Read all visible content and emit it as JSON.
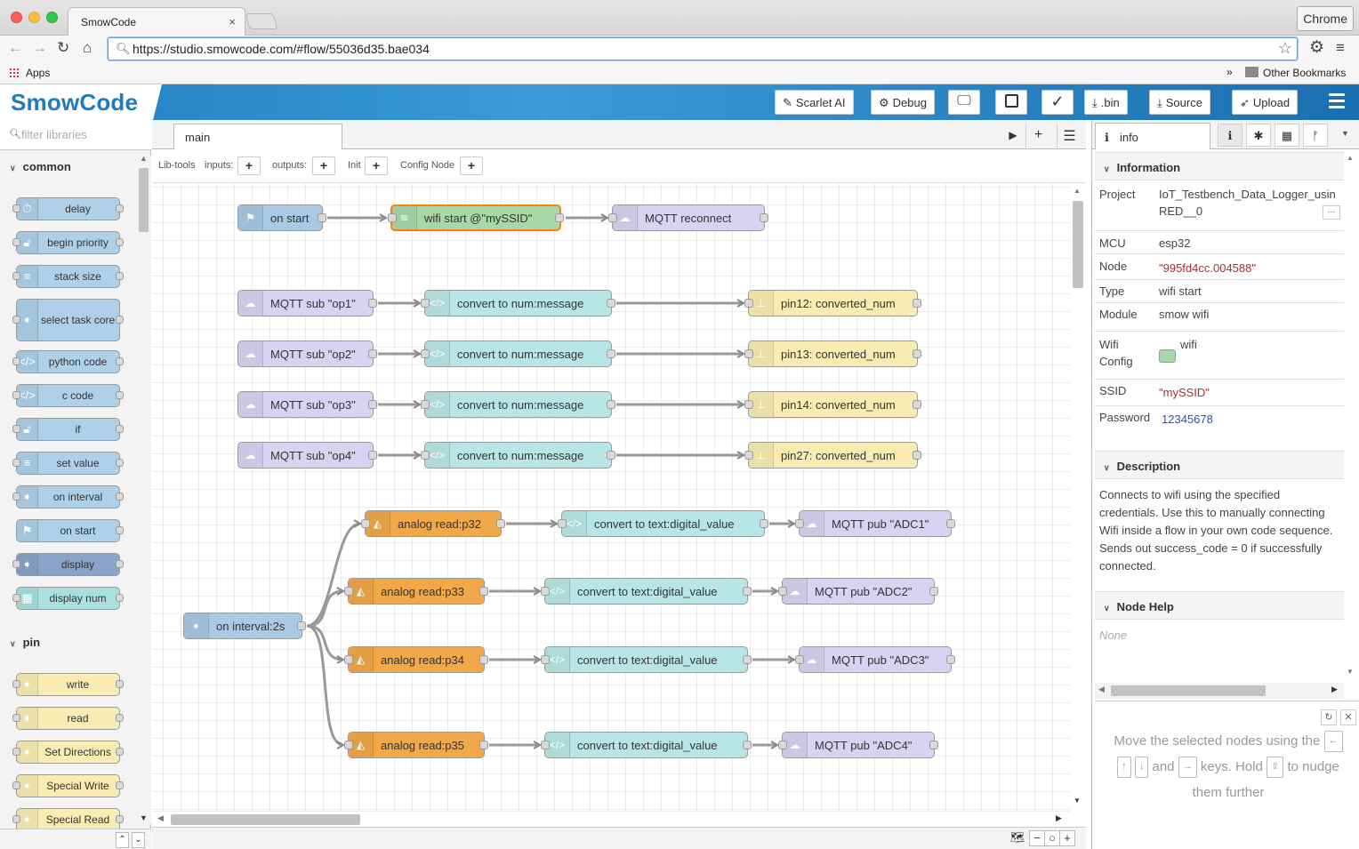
{
  "browser": {
    "tab_title": "SmowCode",
    "tab_close": "×",
    "url": "https://studio.smowcode.com/#flow/55036d35.bae034",
    "chrome_label": "Chrome",
    "bookmarks": {
      "apps": "Apps",
      "overflow": "»",
      "other": "Other Bookmarks"
    }
  },
  "header": {
    "logo": "SmowCode",
    "buttons": {
      "scarlet": "Scarlet AI",
      "debug": "Debug",
      "bin": ".bin",
      "source": "Source",
      "upload": "Upload"
    }
  },
  "palette": {
    "filter_placeholder": "filter libraries",
    "categories": [
      {
        "name": "common",
        "nodes": [
          {
            "label": "delay",
            "color": "#aed0e8"
          },
          {
            "label": "begin priority",
            "color": "#aed0e8"
          },
          {
            "label": "stack size",
            "color": "#aed0e8"
          },
          {
            "label": "select task core",
            "color": "#aed0e8"
          },
          {
            "label": "python code",
            "color": "#aed0e8"
          },
          {
            "label": "c code",
            "color": "#aed0e8"
          },
          {
            "label": "if",
            "color": "#aed0e8"
          },
          {
            "label": "set value",
            "color": "#aed0e8"
          },
          {
            "label": "on interval",
            "color": "#aed0e8"
          },
          {
            "label": "on start",
            "color": "#aed0e8"
          },
          {
            "label": "display",
            "color": "#8aa3c8"
          },
          {
            "label": "display num",
            "color": "#a8e0e0"
          }
        ]
      },
      {
        "name": "pin",
        "nodes": [
          {
            "label": "write",
            "color": "#f8ecb2"
          },
          {
            "label": "read",
            "color": "#f8ecb2"
          },
          {
            "label": "Set Directions",
            "color": "#f8ecb2"
          },
          {
            "label": "Special Write",
            "color": "#f8ecb2"
          },
          {
            "label": "Special Read",
            "color": "#f8ecb2"
          }
        ]
      }
    ]
  },
  "workspace": {
    "tab": "main",
    "libtools": {
      "label": "Lib-tools",
      "inputs": "inputs:",
      "outputs": "outputs:",
      "init": "Init",
      "config": "Config Node"
    },
    "nodes": {
      "on_start": {
        "label": "on start",
        "color": "#a9c9e4"
      },
      "wifi_start": {
        "label": "wifi start @\"mySSID\"",
        "color": "#a8d8a8"
      },
      "mqtt_reconnect": {
        "label": "MQTT reconnect",
        "color": "#d9d2f0"
      },
      "sub1": {
        "label": "MQTT sub \"op1\"",
        "color": "#d9d2f0"
      },
      "sub2": {
        "label": "MQTT sub \"op2\"",
        "color": "#d9d2f0"
      },
      "sub3": {
        "label": "MQTT sub \"op3\"",
        "color": "#d9d2f0"
      },
      "sub4": {
        "label": "MQTT sub \"op4\"",
        "color": "#d9d2f0"
      },
      "conv_num": {
        "label": "convert to num:message",
        "color": "#b8e6e6"
      },
      "pin12": {
        "label": "pin12: converted_num",
        "color": "#f8ecb2"
      },
      "pin13": {
        "label": "pin13: converted_num",
        "color": "#f8ecb2"
      },
      "pin14": {
        "label": "pin14: converted_num",
        "color": "#f8ecb2"
      },
      "pin27": {
        "label": "pin27: converted_num",
        "color": "#f8ecb2"
      },
      "on_interval": {
        "label": "on interval:2s",
        "color": "#a9c9e4"
      },
      "ar32": {
        "label": "analog read:p32",
        "color": "#f0a848"
      },
      "ar33": {
        "label": "analog read:p33",
        "color": "#f0a848"
      },
      "ar34": {
        "label": "analog read:p34",
        "color": "#f0a848"
      },
      "ar35": {
        "label": "analog read:p35",
        "color": "#f0a848"
      },
      "conv_text": {
        "label": "convert to text:digital_value",
        "color": "#b8e6e6"
      },
      "pub1": {
        "label": "MQTT pub \"ADC1\"",
        "color": "#d9d2f0"
      },
      "pub2": {
        "label": "MQTT pub \"ADC2\"",
        "color": "#d9d2f0"
      },
      "pub3": {
        "label": "MQTT pub \"ADC3\"",
        "color": "#d9d2f0"
      },
      "pub4": {
        "label": "MQTT pub \"ADC4\"",
        "color": "#d9d2f0"
      }
    }
  },
  "sidebar": {
    "tab": "info",
    "sections": {
      "information": "Information",
      "description": "Description",
      "node_help": "Node Help"
    },
    "props": {
      "project": {
        "k": "Project",
        "v1": "IoT_Testbench_Data_Logger_usin",
        "v2": "RED__0",
        "more": "···"
      },
      "mcu": {
        "k": "MCU",
        "v": "esp32"
      },
      "node": {
        "k": "Node",
        "v": "\"995fd4cc.004588\""
      },
      "type": {
        "k": "Type",
        "v": "wifi start"
      },
      "module": {
        "k": "Module",
        "v": "smow wifi"
      },
      "wifi_config": {
        "k1": "Wifi",
        "k2": "Config",
        "v": "wifi",
        "swatch": "#a8d8a8"
      },
      "ssid": {
        "k": "SSID",
        "v": "\"mySSID\""
      },
      "password": {
        "k": "Password",
        "v": "12345678"
      }
    },
    "description": "Connects to wifi using the specified credentials. Use this to manually connecting Wifi inside a flow in your own code sequence. Sends out success_code = 0 if successfully connected.",
    "node_help": "None",
    "tip": {
      "t1": "Move the selected nodes using the",
      "k_left": "←",
      "k_up": "↑",
      "k_down": "↓",
      "and": "and",
      "k_right": "→",
      "t2": "keys. Hold",
      "k_shift": "⇧",
      "t3": "to nudge",
      "t4": "them further"
    }
  }
}
